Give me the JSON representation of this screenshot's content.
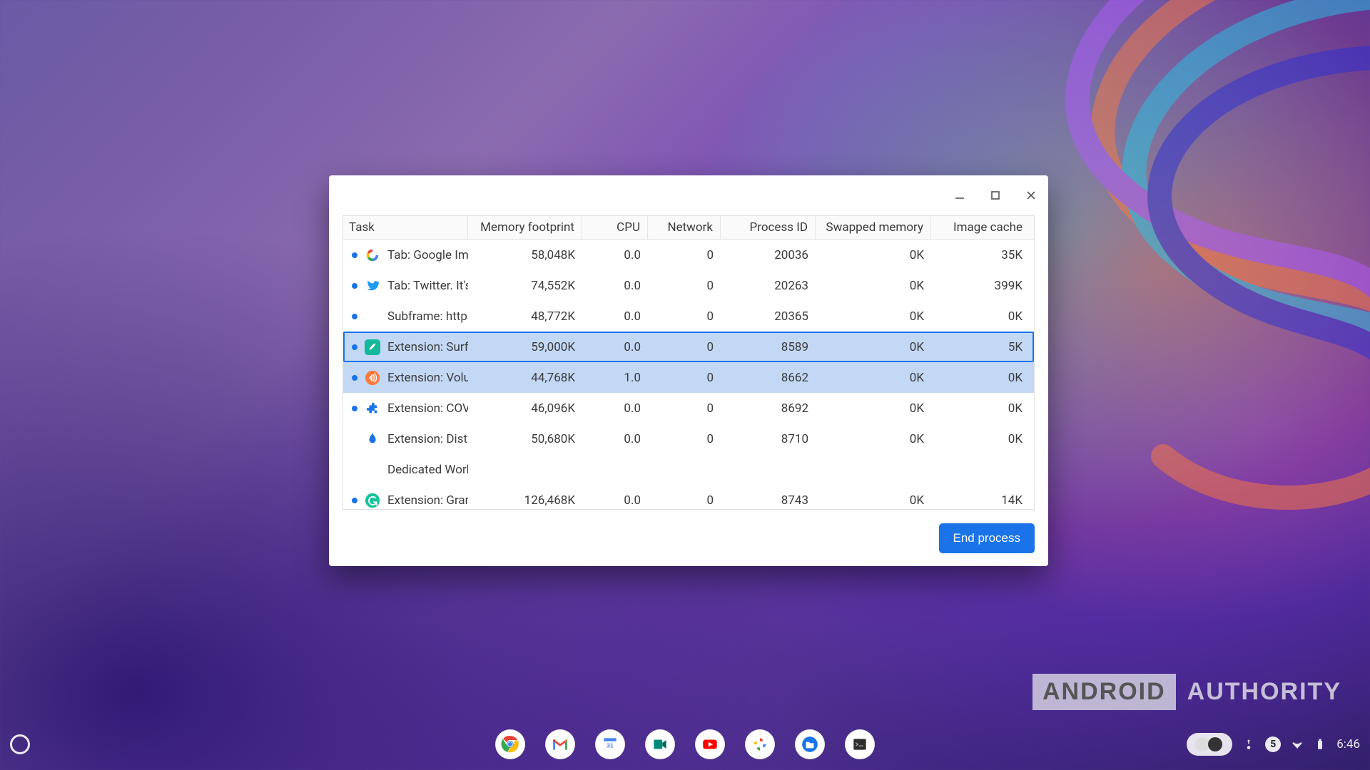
{
  "window": {
    "columns": {
      "task": "Task",
      "memory": "Memory footprint",
      "cpu": "CPU",
      "network": "Network",
      "pid": "Process ID",
      "swapped": "Swapped memory",
      "imgcache": "Image cache"
    },
    "rows": [
      {
        "dot": true,
        "icon": "google-icon",
        "label": "Tab: Google Ima",
        "memory": "58,048K",
        "cpu": "0.0",
        "network": "0",
        "pid": "20036",
        "swap": "0K",
        "imgcache": "35K",
        "selected": false
      },
      {
        "dot": true,
        "icon": "twitter-icon",
        "label": "Tab: Twitter. It's",
        "memory": "74,552K",
        "cpu": "0.0",
        "network": "0",
        "pid": "20263",
        "swap": "0K",
        "imgcache": "399K",
        "selected": false
      },
      {
        "dot": true,
        "icon": "",
        "label": "Subframe: https",
        "memory": "48,772K",
        "cpu": "0.0",
        "network": "0",
        "pid": "20365",
        "swap": "0K",
        "imgcache": "0K",
        "selected": false
      },
      {
        "dot": true,
        "icon": "surf-icon",
        "label": "Extension: Surfs",
        "memory": "59,000K",
        "cpu": "0.0",
        "network": "0",
        "pid": "8589",
        "swap": "0K",
        "imgcache": "5K",
        "selected": true,
        "focus": true
      },
      {
        "dot": true,
        "icon": "volume-icon",
        "label": "Extension: Volu",
        "memory": "44,768K",
        "cpu": "1.0",
        "network": "0",
        "pid": "8662",
        "swap": "0K",
        "imgcache": "0K",
        "selected": true
      },
      {
        "dot": true,
        "icon": "puzzle-icon",
        "label": "Extension: COVI",
        "memory": "46,096K",
        "cpu": "0.0",
        "network": "0",
        "pid": "8692",
        "swap": "0K",
        "imgcache": "0K",
        "selected": false
      },
      {
        "dot": false,
        "icon": "distill-icon",
        "label": "Extension: Disti",
        "memory": "50,680K",
        "cpu": "0.0",
        "network": "0",
        "pid": "8710",
        "swap": "0K",
        "imgcache": "0K",
        "selected": false,
        "tree": true
      },
      {
        "dot": false,
        "icon": "",
        "label": "Dedicated Worke",
        "memory": "",
        "cpu": "",
        "network": "",
        "pid": "",
        "swap": "",
        "imgcache": "",
        "selected": false,
        "tree": true
      },
      {
        "dot": true,
        "icon": "grammarly-icon",
        "label": "Extension: Gram",
        "memory": "126,468K",
        "cpu": "0.0",
        "network": "0",
        "pid": "8743",
        "swap": "0K",
        "imgcache": "14K",
        "selected": false
      }
    ],
    "end_process": "End process"
  },
  "shelf": {
    "apps": [
      {
        "name": "chrome-icon"
      },
      {
        "name": "gmail-icon"
      },
      {
        "name": "calendar-icon"
      },
      {
        "name": "meet-icon"
      },
      {
        "name": "youtube-icon"
      },
      {
        "name": "photos-icon"
      },
      {
        "name": "files-icon"
      },
      {
        "name": "terminal-icon"
      }
    ]
  },
  "tray": {
    "badge": "5",
    "time": "6:46"
  },
  "watermark": {
    "boxed": "ANDROID",
    "plain": "AUTHORITY"
  }
}
